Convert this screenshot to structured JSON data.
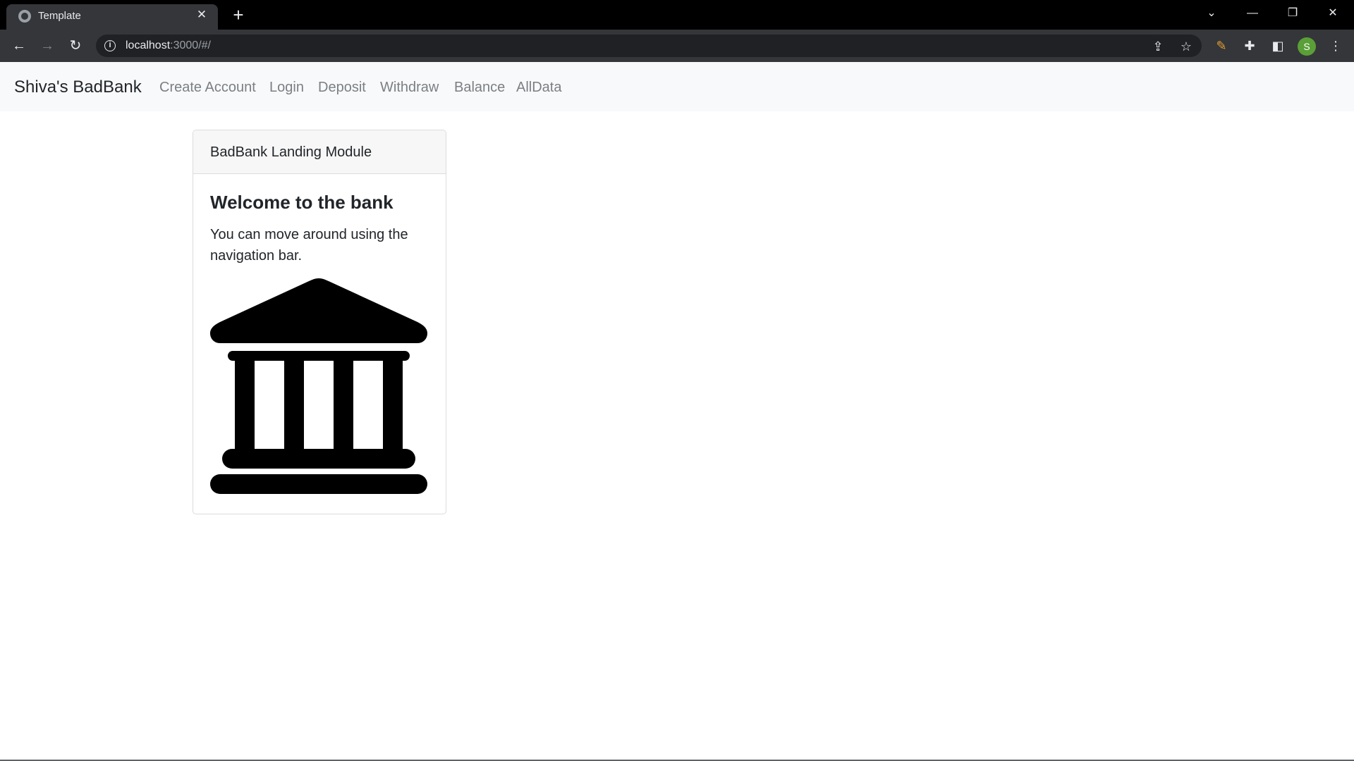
{
  "browser": {
    "tab_title": "Template",
    "url_host": "localhost",
    "url_rest": ":3000/#/",
    "profile_initial": "S"
  },
  "navbar": {
    "brand": "Shiva's BadBank",
    "links": [
      "Create Account",
      "Login",
      "Deposit",
      "Withdraw",
      "Balance",
      "AllData"
    ]
  },
  "card": {
    "header": "BadBank Landing Module",
    "title": "Welcome to the bank",
    "text": "You can move around using the navigation bar.",
    "icon": "bank-icon"
  }
}
